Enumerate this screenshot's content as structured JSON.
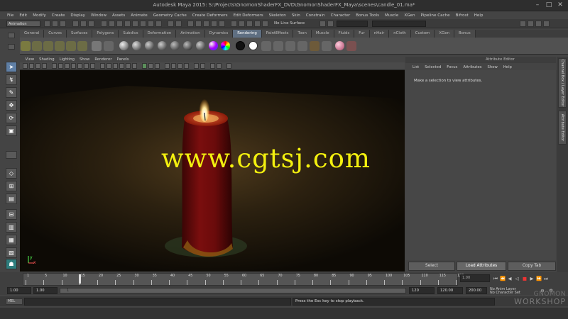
{
  "window": {
    "title": "Autodesk Maya 2015: S:\\Projects\\GnomonShaderFX_DVD\\GnomonShaderFX_Maya\\scenes\\candle_01.ma*",
    "controls": [
      "–",
      "□",
      "✕"
    ]
  },
  "menubar": [
    "File",
    "Edit",
    "Modify",
    "Create",
    "Display",
    "Window",
    "Assets",
    "Animate",
    "Geometry Cache",
    "Create Deformers",
    "Edit Deformers",
    "Skeleton",
    "Skin",
    "Constrain",
    "Character",
    "Bonus Tools",
    "Muscle",
    "XGen",
    "Pipeline Cache",
    "Bifrost",
    "Help"
  ],
  "statusline": {
    "mode": "Animation",
    "live_surface": "No Live Surface"
  },
  "shelf": {
    "tabs": [
      "General",
      "Curves",
      "Surfaces",
      "Polygons",
      "Subdivs",
      "Deformation",
      "Animation",
      "Dynamics",
      "Rendering",
      "PaintEffects",
      "Toon",
      "Muscle",
      "Fluids",
      "Fur",
      "nHair",
      "nCloth",
      "Custom",
      "XGen",
      "Bonus"
    ],
    "active_tab": "Rendering"
  },
  "viewport": {
    "menu": [
      "View",
      "Shading",
      "Lighting",
      "Show",
      "Renderer",
      "Panels"
    ],
    "axis_x": "x",
    "axis_y": "y"
  },
  "overlay_text": "www.cgtsj.com",
  "attribute_editor": {
    "title": "Attribute Editor",
    "menu": [
      "List",
      "Selected",
      "Focus",
      "Attributes",
      "Show",
      "Help"
    ],
    "message": "Make a selection to view attributes.",
    "buttons": {
      "select": "Select",
      "load": "Load Attributes",
      "copy": "Copy Tab"
    }
  },
  "side_tabs": [
    "Channel Box / Layer Editor",
    "Attribute Editor"
  ],
  "time_slider": {
    "ticks": [
      "1",
      "5",
      "10",
      "15",
      "20",
      "25",
      "30",
      "35",
      "40",
      "45",
      "50",
      "55",
      "60",
      "65",
      "70",
      "75",
      "80",
      "85",
      "90",
      "95",
      "100",
      "105",
      "110",
      "115",
      "120"
    ],
    "current_frame": "1.00"
  },
  "range_slider": {
    "start": "1.00",
    "playback_start": "1.00",
    "range_label": "1",
    "playback_end": "120",
    "end": "120.00",
    "anim_end": "200.00",
    "anim_layer": "No Anim Layer",
    "character_set": "No Character Set"
  },
  "command_line": {
    "label": "MEL",
    "result": "Press the Esc key to stop playback."
  },
  "watermark": {
    "line1": "GNOMON",
    "line2": "WORKSHOP"
  },
  "colors": {
    "overlay": "#f3f00f",
    "active_tab": "#5f6f82",
    "candle": "#6e0a0a",
    "flame": "#ffe9a0"
  }
}
